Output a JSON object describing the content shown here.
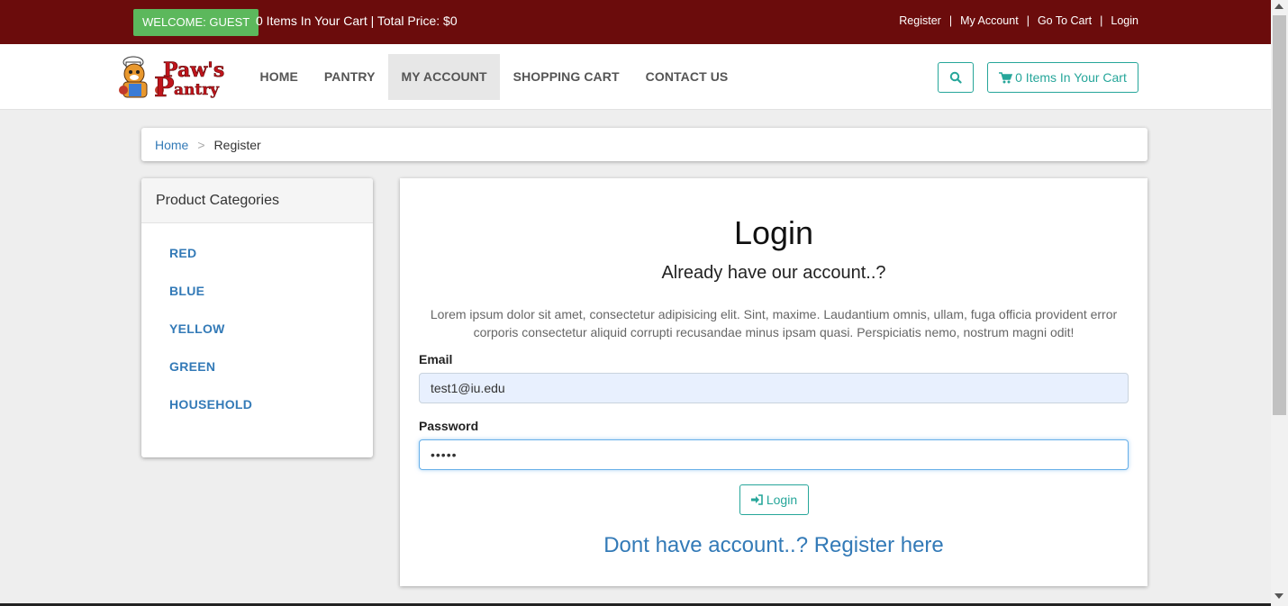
{
  "topbar": {
    "welcome": "WELCOME: GUEST",
    "cart_summary": "0 Items In Your Cart | Total Price: $0",
    "links": [
      "Register",
      "My Account",
      "Go To Cart",
      "Login"
    ],
    "background": "#6b0c0c"
  },
  "navbar": {
    "logo_line1": "Paw's",
    "logo_line2": "antry",
    "items": [
      {
        "label": "HOME"
      },
      {
        "label": "PANTRY"
      },
      {
        "label": "MY ACCOUNT",
        "active": true
      },
      {
        "label": "SHOPPING CART"
      },
      {
        "label": "CONTACT US"
      }
    ],
    "search_icon": "search-icon",
    "cart_button_label": "0 Items In Your Cart",
    "cart_icon": "shopping-cart-icon"
  },
  "breadcrumb": {
    "home": "Home",
    "separator": ">",
    "current": "Register"
  },
  "sidebar": {
    "title": "Product Categories",
    "categories": [
      "RED",
      "BLUE",
      "YELLOW",
      "GREEN",
      "HOUSEHOLD"
    ]
  },
  "login": {
    "title": "Login",
    "subtitle": "Already have our account..?",
    "description": "Lorem ipsum dolor sit amet, consectetur adipisicing elit. Sint, maxime. Laudantium omnis, ullam, fuga officia provident error corporis consectetur aliquid corrupti recusandae minus ipsam quasi. Perspiciatis nemo, nostrum magni odit!",
    "email_label": "Email",
    "email_value": "test1@iu.edu",
    "password_label": "Password",
    "password_value": "•••••",
    "button_label": "Login",
    "button_icon": "sign-in-icon",
    "register_link": "Dont have account..? Register here"
  },
  "colors": {
    "accent": "#26a69a",
    "link": "#337ab7",
    "success": "#5cb85c"
  }
}
